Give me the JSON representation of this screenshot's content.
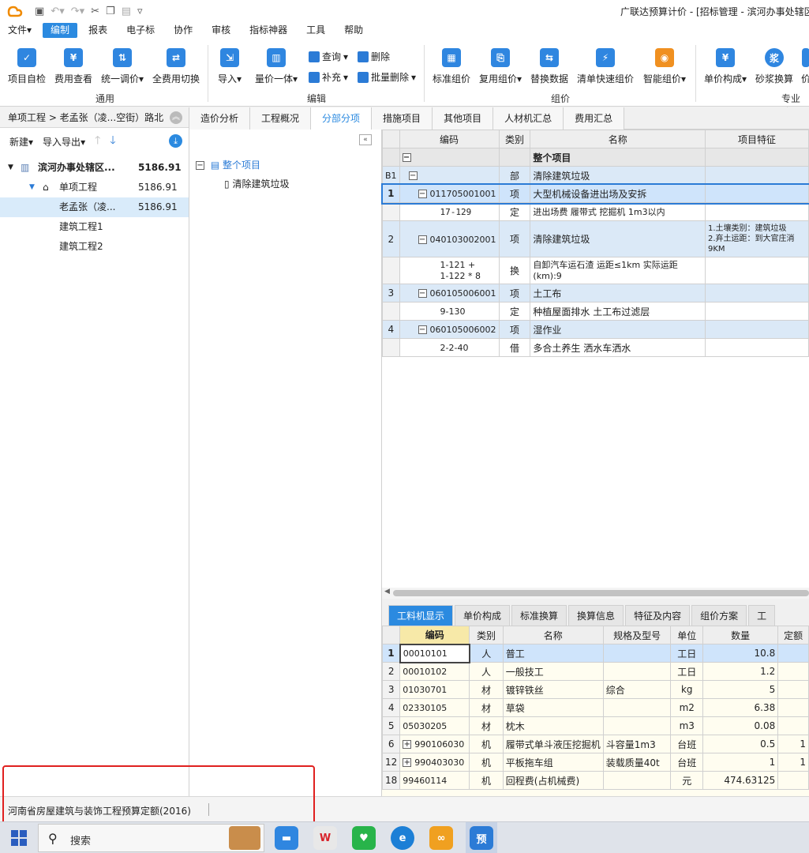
{
  "window": {
    "title": "广联达预算计价 - [招标管理 - 滨河办事处辖区"
  },
  "menu": [
    "文件",
    "编制",
    "报表",
    "电子标",
    "协作",
    "审核",
    "指标神器",
    "工具",
    "帮助"
  ],
  "ribbon": {
    "buttons": {
      "b1": "项目自检",
      "b2": "费用查看",
      "b3": "统一调价",
      "b4": "全费用切换",
      "b5": "导入",
      "b6": "量价一体",
      "b7": "查询",
      "b8": "补充",
      "b9": "删除",
      "b10": "批量删除",
      "b11": "标准组价",
      "b12": "复用组价",
      "b13": "替换数据",
      "b14": "清单快速组价",
      "b15": "智能组价",
      "b16": "单价构成",
      "b17": "砂浆换算",
      "b18": "价"
    },
    "groups": {
      "g1": "通用",
      "g2": "编辑",
      "g3": "组价",
      "g4": "专业功"
    }
  },
  "left": {
    "breadcrumb": "单项工程 > 老孟张（凌...空街）路北",
    "tools": {
      "new": "新建",
      "import_export": "导入导出"
    },
    "tree": [
      {
        "label": "滨河办事处辖区...",
        "value": "5186.91"
      },
      {
        "label": "单项工程",
        "value": "5186.91"
      },
      {
        "label": "老孟张（凌...",
        "value": "5186.91"
      },
      {
        "label": "建筑工程1",
        "value": ""
      },
      {
        "label": "建筑工程2",
        "value": ""
      }
    ],
    "status": "河南省房屋建筑与装饰工程预算定额(2016)"
  },
  "tabs": [
    "造价分析",
    "工程概况",
    "分部分项",
    "措施项目",
    "其他项目",
    "人材机汇总",
    "费用汇总"
  ],
  "midtree": {
    "root": "整个项目",
    "child": "清除建筑垃圾"
  },
  "grid": {
    "headers": [
      "编码",
      "类别",
      "名称",
      "项目特征"
    ],
    "rows": {
      "r0": {
        "idx": "",
        "code": "",
        "type": "",
        "name": "整个项目",
        "feature": ""
      },
      "r1": {
        "idx": "B1",
        "code": "",
        "type": "部",
        "name": "清除建筑垃圾",
        "feature": ""
      },
      "r2": {
        "idx": "1",
        "code": "011705001001",
        "type": "项",
        "name": "大型机械设备进出场及安拆",
        "feature": ""
      },
      "r3": {
        "idx": "",
        "code": "17-129",
        "type": "定",
        "name": "进出场费 履带式 挖掘机 1m3以内",
        "feature": ""
      },
      "r4": {
        "idx": "2",
        "code": "040103002001",
        "type": "项",
        "name": "清除建筑垃圾",
        "feature1": "1.土壤类别：建筑垃圾",
        "feature2": "2.弃土运距：到大官庄消",
        "feature3": "9KM"
      },
      "r5": {
        "idx": "",
        "code1": "1-121 +",
        "code2": "1-122 * 8",
        "type": "换",
        "name1": "自卸汽车运石渣 运距≤1km  实际运距",
        "name2": "(km):9",
        "feature": ""
      },
      "r6": {
        "idx": "3",
        "code": "060105006001",
        "type": "项",
        "name": "土工布",
        "feature": ""
      },
      "r7": {
        "idx": "",
        "code": "9-130",
        "type": "定",
        "name": "种植屋面排水 土工布过滤层",
        "feature": ""
      },
      "r8": {
        "idx": "4",
        "code": "060105006002",
        "type": "项",
        "name": "湿作业",
        "feature": ""
      },
      "r9": {
        "idx": "",
        "code": "2-2-40",
        "type": "借",
        "name": "多合土养生 洒水车洒水",
        "feature": ""
      }
    }
  },
  "bottom_tabs": [
    "工料机显示",
    "单价构成",
    "标准换算",
    "换算信息",
    "特征及内容",
    "组价方案",
    "工"
  ],
  "grid2": {
    "headers": [
      "编码",
      "类别",
      "名称",
      "规格及型号",
      "单位",
      "数量",
      "定额"
    ],
    "rows": [
      {
        "idx": "1",
        "code": "00010101",
        "type": "人",
        "name": "普工",
        "spec": "",
        "unit": "工日",
        "qty": "10.8",
        "extra": ""
      },
      {
        "idx": "2",
        "code": "00010102",
        "type": "人",
        "name": "一般技工",
        "spec": "",
        "unit": "工日",
        "qty": "1.2",
        "extra": ""
      },
      {
        "idx": "3",
        "code": "01030701",
        "type": "材",
        "name": "镀锌铁丝",
        "spec": "综合",
        "unit": "kg",
        "qty": "5",
        "extra": ""
      },
      {
        "idx": "4",
        "code": "02330105",
        "type": "材",
        "name": "草袋",
        "spec": "",
        "unit": "m2",
        "qty": "6.38",
        "extra": ""
      },
      {
        "idx": "5",
        "code": "05030205",
        "type": "材",
        "name": "枕木",
        "spec": "",
        "unit": "m3",
        "qty": "0.08",
        "extra": ""
      },
      {
        "idx": "6",
        "code": "990106030",
        "type": "机",
        "name": "履带式单斗液压挖掘机",
        "spec": "斗容量1m3",
        "unit": "台班",
        "qty": "0.5",
        "extra": "1"
      },
      {
        "idx": "12",
        "code": "990403030",
        "type": "机",
        "name": "平板拖车组",
        "spec": "装载质量40t",
        "unit": "台班",
        "qty": "1",
        "extra": "1"
      },
      {
        "idx": "18",
        "code": "99460114",
        "type": "机",
        "name": "回程费(占机械费)",
        "spec": "",
        "unit": "元",
        "qty": "474.63125",
        "extra": ""
      }
    ]
  },
  "taskbar": {
    "search": "搜索",
    "active_app": "预"
  },
  "colors": {
    "accent": "#2b8ae0",
    "highlight_box": "#e0201f"
  }
}
